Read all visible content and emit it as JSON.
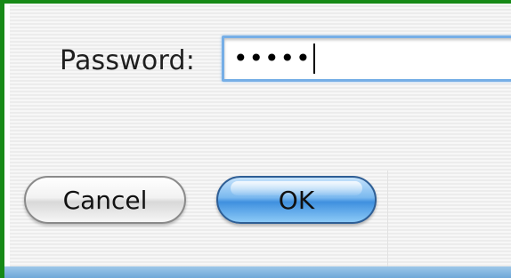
{
  "dialog": {
    "password_label": "Password:",
    "password_value": "•••••",
    "cancel_label": "Cancel",
    "ok_label": "OK"
  },
  "colors": {
    "window_border": "#178a17",
    "field_focus_ring": "#76aee6",
    "default_button": "#3f90df"
  }
}
